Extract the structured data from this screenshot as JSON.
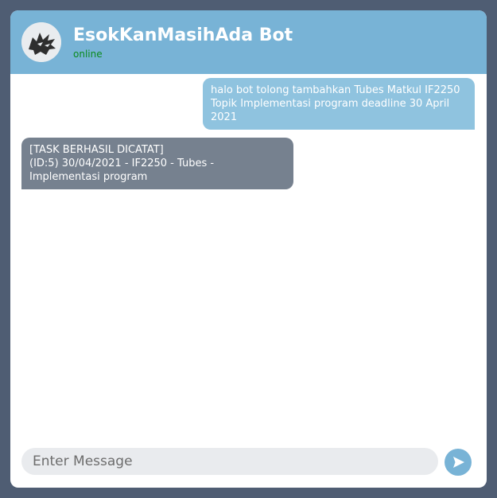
{
  "header": {
    "title": "EsokKanMasihAda Bot",
    "status": "online",
    "avatar_icon": "wolf-icon"
  },
  "messages": [
    {
      "sender": "user",
      "lines": [
        "halo bot tolong tambahkan Tubes Matkul IF2250 Topik Implementasi program deadline 30 April 2021"
      ]
    },
    {
      "sender": "bot",
      "lines": [
        "[TASK BERHASIL DICATAT]",
        "(ID:5) 30/04/2021 - IF2250 - Tubes - Implementasi program"
      ]
    }
  ],
  "composer": {
    "placeholder": "Enter Message",
    "send_icon": "send-icon"
  },
  "colors": {
    "page_background": "#4f5d73",
    "header_background": "#78b3d6",
    "user_bubble": "#8fc3df",
    "bot_bubble": "#76818f",
    "status_text": "#0a8a1c"
  }
}
